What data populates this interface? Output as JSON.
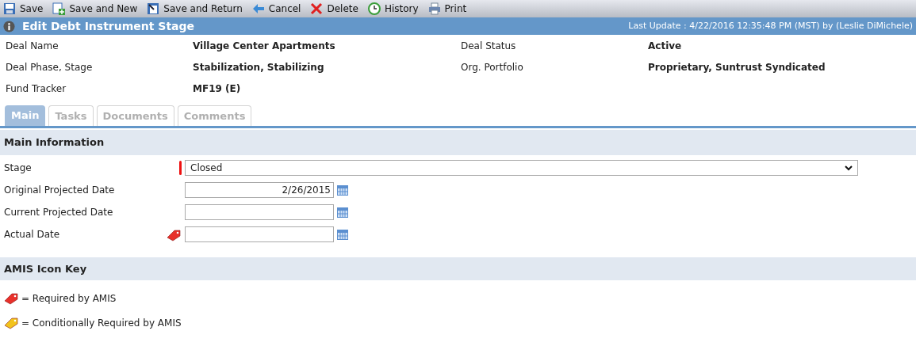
{
  "toolbar": [
    {
      "label": "Save",
      "kind": "save"
    },
    {
      "label": "Save and New",
      "kind": "new"
    },
    {
      "label": "Save and Return",
      "kind": "return"
    },
    {
      "label": "Cancel",
      "kind": "cancel"
    },
    {
      "label": "Delete",
      "kind": "delete"
    },
    {
      "label": "History",
      "kind": "history"
    },
    {
      "label": "Print",
      "kind": "print"
    }
  ],
  "header": {
    "title": "Edit Debt Instrument Stage",
    "last_update": "Last Update : 4/22/2016 12:35:48 PM (MST) by (Leslie DiMichele)"
  },
  "summary": [
    {
      "label": "Deal Name",
      "value": "Village Center Apartments"
    },
    {
      "label": "Deal Status",
      "value": "Active"
    },
    {
      "label": "Deal Phase, Stage",
      "value": "Stabilization, Stabilizing"
    },
    {
      "label": "Org. Portfolio",
      "value": "Proprietary, Suntrust Syndicated"
    },
    {
      "label": "Fund Tracker",
      "value": "MF19 (E)"
    }
  ],
  "tabs": [
    {
      "label": "Main",
      "selected": true
    },
    {
      "label": "Tasks",
      "selected": false
    },
    {
      "label": "Documents",
      "selected": false
    },
    {
      "label": "Comments",
      "selected": false
    }
  ],
  "main_section": {
    "title": "Main Information",
    "fields": [
      {
        "label": "Stage",
        "kind": "select",
        "value": "Closed",
        "required": true
      },
      {
        "label": "Original Projected Date",
        "kind": "date",
        "value": "2/26/2015"
      },
      {
        "label": "Current Projected Date",
        "kind": "date"
      },
      {
        "label": "Actual Date",
        "kind": "date",
        "color": "#e8302a"
      }
    ]
  },
  "key_section": {
    "title": "AMIS Icon Key",
    "items": [
      {
        "text": "= Required by AMIS",
        "color": "#e8302a"
      },
      {
        "text": "= Conditionally Required by AMIS",
        "color": "#f2c31c"
      }
    ]
  }
}
